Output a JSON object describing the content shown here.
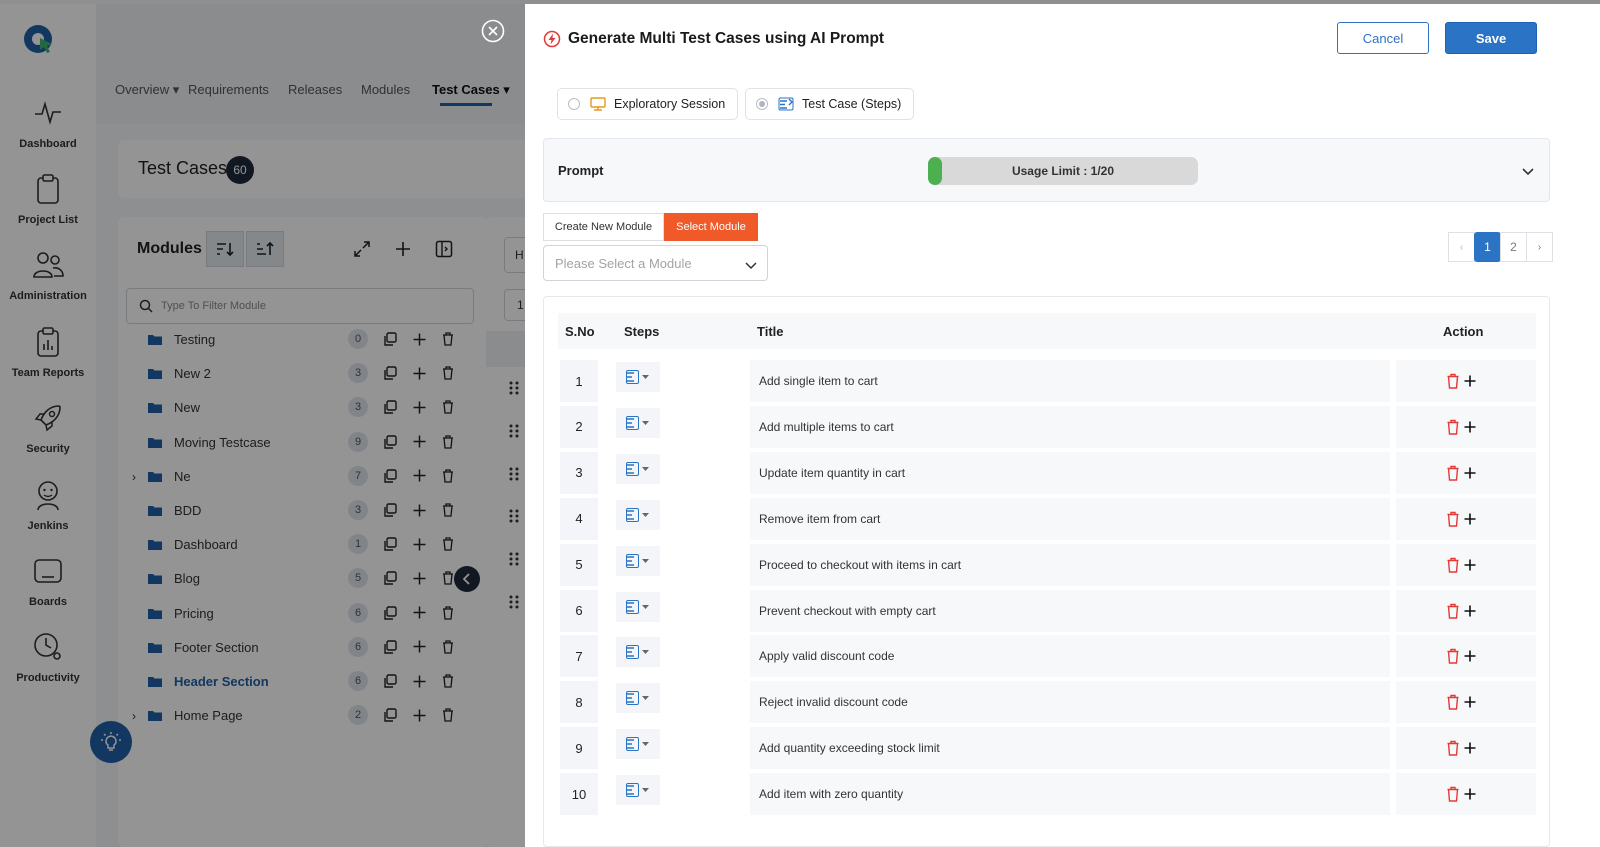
{
  "sidebar": {
    "items": [
      {
        "label": "Dashboard",
        "icon": "activity-icon"
      },
      {
        "label": "Project List",
        "icon": "clipboard-icon"
      },
      {
        "label": "Administration",
        "icon": "users-icon"
      },
      {
        "label": "Team Reports",
        "icon": "report-icon"
      },
      {
        "label": "Security",
        "icon": "rocket-icon"
      },
      {
        "label": "Jenkins",
        "icon": "jenkins-icon"
      },
      {
        "label": "Boards",
        "icon": "board-icon"
      },
      {
        "label": "Productivity",
        "icon": "clock-gear-icon"
      }
    ]
  },
  "topnav": {
    "overview": "Overview",
    "requirements": "Requirements",
    "releases": "Releases",
    "modules": "Modules",
    "test_cases": "Test Cases"
  },
  "page": {
    "title": "Test Cases",
    "count": "60"
  },
  "modules": {
    "title": "Modules",
    "filter_placeholder": "Type To Filter Module",
    "items": [
      {
        "name": "Testing",
        "count": "0"
      },
      {
        "name": "New 2",
        "count": "3"
      },
      {
        "name": "New",
        "count": "3"
      },
      {
        "name": "Moving Testcase",
        "count": "9"
      },
      {
        "name": "Ne",
        "count": "7"
      },
      {
        "name": "BDD",
        "count": "3"
      },
      {
        "name": "Dashboard",
        "count": "1"
      },
      {
        "name": "Blog",
        "count": "5"
      },
      {
        "name": "Pricing",
        "count": "6"
      },
      {
        "name": "Footer Section",
        "count": "6"
      },
      {
        "name": "Header Section",
        "count": "6"
      },
      {
        "name": "Home Page",
        "count": "2"
      }
    ]
  },
  "list_panel": {
    "peek_header": "H",
    "peek_value": "1"
  },
  "modal": {
    "title": "Generate Multi Test Cases using AI Prompt",
    "cancel_label": "Cancel",
    "save_label": "Save",
    "modes": {
      "exploratory": "Exploratory Session",
      "test_case_steps": "Test Case (Steps)"
    },
    "prompt": {
      "label": "Prompt",
      "usage_text": "Usage Limit : 1/20",
      "usage_used": 1,
      "usage_max": 20
    },
    "module_tabs": {
      "create": "Create New Module",
      "select": "Select Module"
    },
    "module_select_placeholder": "Please Select a Module",
    "pagination": {
      "prev": "‹",
      "pages": [
        "1",
        "2"
      ],
      "next": "›"
    },
    "table": {
      "headers": {
        "sno": "S.No",
        "steps": "Steps",
        "title": "Title",
        "action": "Action"
      },
      "rows": [
        {
          "sno": "1",
          "title": "Add single item to cart"
        },
        {
          "sno": "2",
          "title": "Add multiple items to cart"
        },
        {
          "sno": "3",
          "title": "Update item quantity in cart"
        },
        {
          "sno": "4",
          "title": "Remove item from cart"
        },
        {
          "sno": "5",
          "title": "Proceed to checkout with items in cart"
        },
        {
          "sno": "6",
          "title": "Prevent checkout with empty cart"
        },
        {
          "sno": "7",
          "title": "Apply valid discount code"
        },
        {
          "sno": "8",
          "title": "Reject invalid discount code"
        },
        {
          "sno": "9",
          "title": "Add quantity exceeding stock limit"
        },
        {
          "sno": "10",
          "title": "Add item with zero quantity"
        }
      ]
    }
  },
  "colors": {
    "primary": "#2b73c4",
    "accent_orange": "#ef5a28",
    "usage_green": "#4caf50",
    "delete_red": "#e53935"
  }
}
